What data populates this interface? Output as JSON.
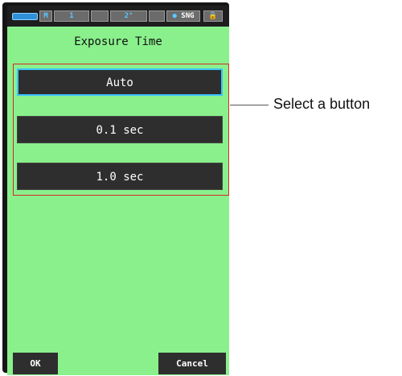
{
  "status_bar": {
    "indicators": [
      "M",
      "1",
      "2°",
      "SNG"
    ],
    "icons": [
      "battery-icon",
      "circle-icon",
      "lock-icon"
    ]
  },
  "screen": {
    "title": "Exposure Time",
    "options": [
      "Auto",
      "0.1 sec",
      "1.0 sec"
    ],
    "selected_option": "Auto",
    "ok_label": "OK",
    "cancel_label": "Cancel"
  },
  "callout": {
    "text": "Select a button"
  },
  "colors": {
    "screen_background": "#8af08c",
    "button_background": "#2e2e2e",
    "selection_highlight": "#3cc2ff",
    "callout_frame": "#d22a2a"
  }
}
